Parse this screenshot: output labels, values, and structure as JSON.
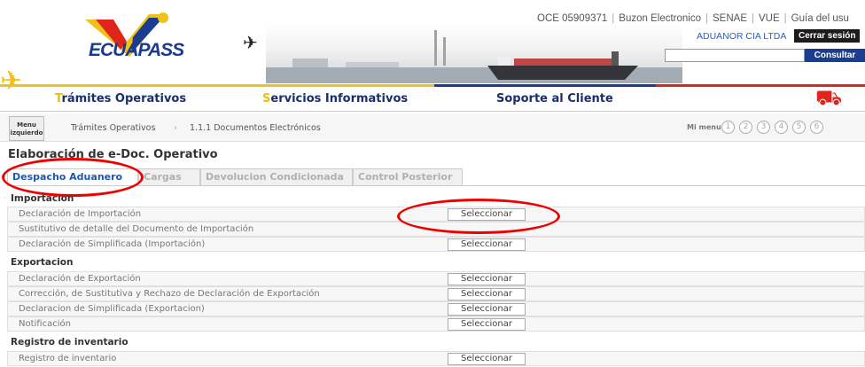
{
  "header": {
    "logo_text": "ECUAPASS",
    "top_links": [
      "OCE 05909371",
      "Buzon Electronico",
      "SENAE",
      "VUE",
      "Guía del usu"
    ],
    "company": "ADUANOR CIA LTDA",
    "logout_label": "Cerrar sesión",
    "search_button": "Consultar"
  },
  "nav": {
    "items": [
      {
        "cap": "T",
        "rest": "rámites Operativos",
        "stripe": "#f2c118"
      },
      {
        "cap": "S",
        "rest": "ervicios Informativos",
        "stripe": "#f2c118"
      },
      {
        "cap": "",
        "rest": "Soporte al Cliente",
        "stripe": "#1b3d8f"
      }
    ]
  },
  "breadcrumb": {
    "menu_label": "Menu izquierdo",
    "items": [
      "Trámites Operativos",
      "1.1.1 Documentos Electrónicos"
    ],
    "mi_menu": "Mi menu",
    "circles": [
      "1",
      "2",
      "3",
      "4",
      "5",
      "6"
    ]
  },
  "page": {
    "title": "Elaboración de e-Doc. Operativo",
    "tabs": [
      "Despacho Aduanero",
      "Cargas",
      "Devolucion Condicionada",
      "Control Posterior"
    ]
  },
  "sections": [
    {
      "title": "Importacion",
      "rows": [
        {
          "label": "Declaración de Importación",
          "button": "Seleccionar"
        },
        {
          "label": "Sustitutivo de detalle del Documento de Importación",
          "button": ""
        },
        {
          "label": "Declaración de Simplificada (Importación)",
          "button": "Seleccionar"
        }
      ]
    },
    {
      "title": "Exportacion",
      "rows": [
        {
          "label": "Declaración de Exportación",
          "button": "Seleccionar"
        },
        {
          "label": "Corrección, de Sustitutiva y Rechazo de Declaración de Exportación",
          "button": "Seleccionar"
        },
        {
          "label": "Declaracion de Simplificada (Exportacion)",
          "button": "Seleccionar"
        },
        {
          "label": "Notificación",
          "button": "Seleccionar"
        }
      ]
    },
    {
      "title": "Registro de inventario",
      "rows": [
        {
          "label": "Registro de inventario",
          "button": "Seleccionar"
        }
      ]
    }
  ],
  "colors": {
    "brand_blue": "#1b3d8f",
    "accent_yellow": "#f2c118",
    "highlight_red": "#ee0000"
  }
}
